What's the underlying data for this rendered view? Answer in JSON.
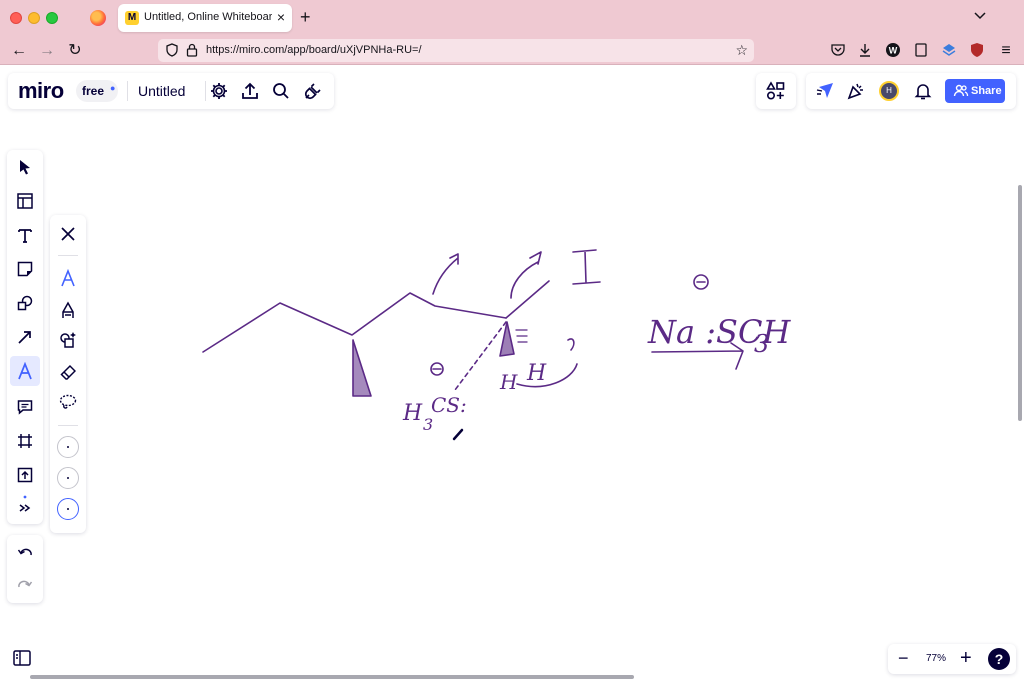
{
  "browser": {
    "tab_title": "Untitled, Online Whiteboard for",
    "url": "https://miro.com/app/board/uXjVPNHa-RU=/"
  },
  "miro": {
    "logo": "miro",
    "plan": "free",
    "board_name": "Untitled",
    "share_label": "Share",
    "avatar_initial": "H",
    "zoom": "77%",
    "help": "?",
    "brand_color": "#4262ff"
  },
  "drawing": {
    "ink_color": "#5b2a86",
    "labels": {
      "iodide": "I",
      "reagent": "Na :SCH",
      "reagent_sub": "3",
      "minus1": "⊖",
      "minus2": "⊖",
      "nucleophile": "H",
      "nucleophile_sub": "3",
      "nucleophile_rest": "CS:",
      "h_left": "H",
      "h_right": "H"
    }
  }
}
